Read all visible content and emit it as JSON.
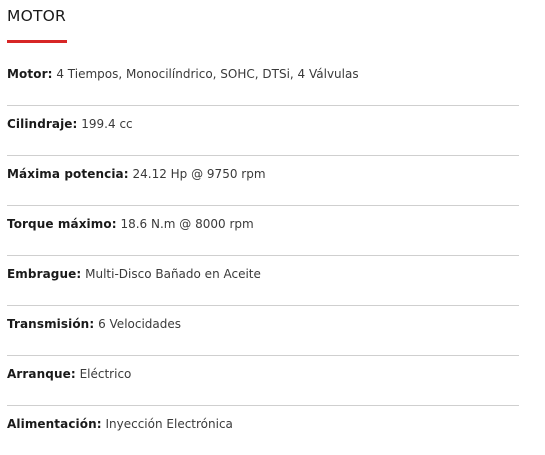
{
  "section": {
    "title": "MOTOR",
    "accent_color": "#d72626"
  },
  "specs": [
    {
      "label": "Motor",
      "value": "4 Tiempos, Monocilíndrico, SOHC, DTSi, 4 Válvulas"
    },
    {
      "label": "Cilindraje",
      "value": "199.4 cc"
    },
    {
      "label": "Máxima potencia",
      "value": "24.12 Hp @ 9750 rpm"
    },
    {
      "label": "Torque máximo",
      "value": "18.6 N.m @ 8000 rpm"
    },
    {
      "label": "Embrague",
      "value": "Multi-Disco Bañado en Aceite"
    },
    {
      "label": "Transmisión",
      "value": "6 Velocidades"
    },
    {
      "label": "Arranque",
      "value": "Eléctrico"
    },
    {
      "label": "Alimentación",
      "value": "Inyección Electrónica"
    }
  ]
}
